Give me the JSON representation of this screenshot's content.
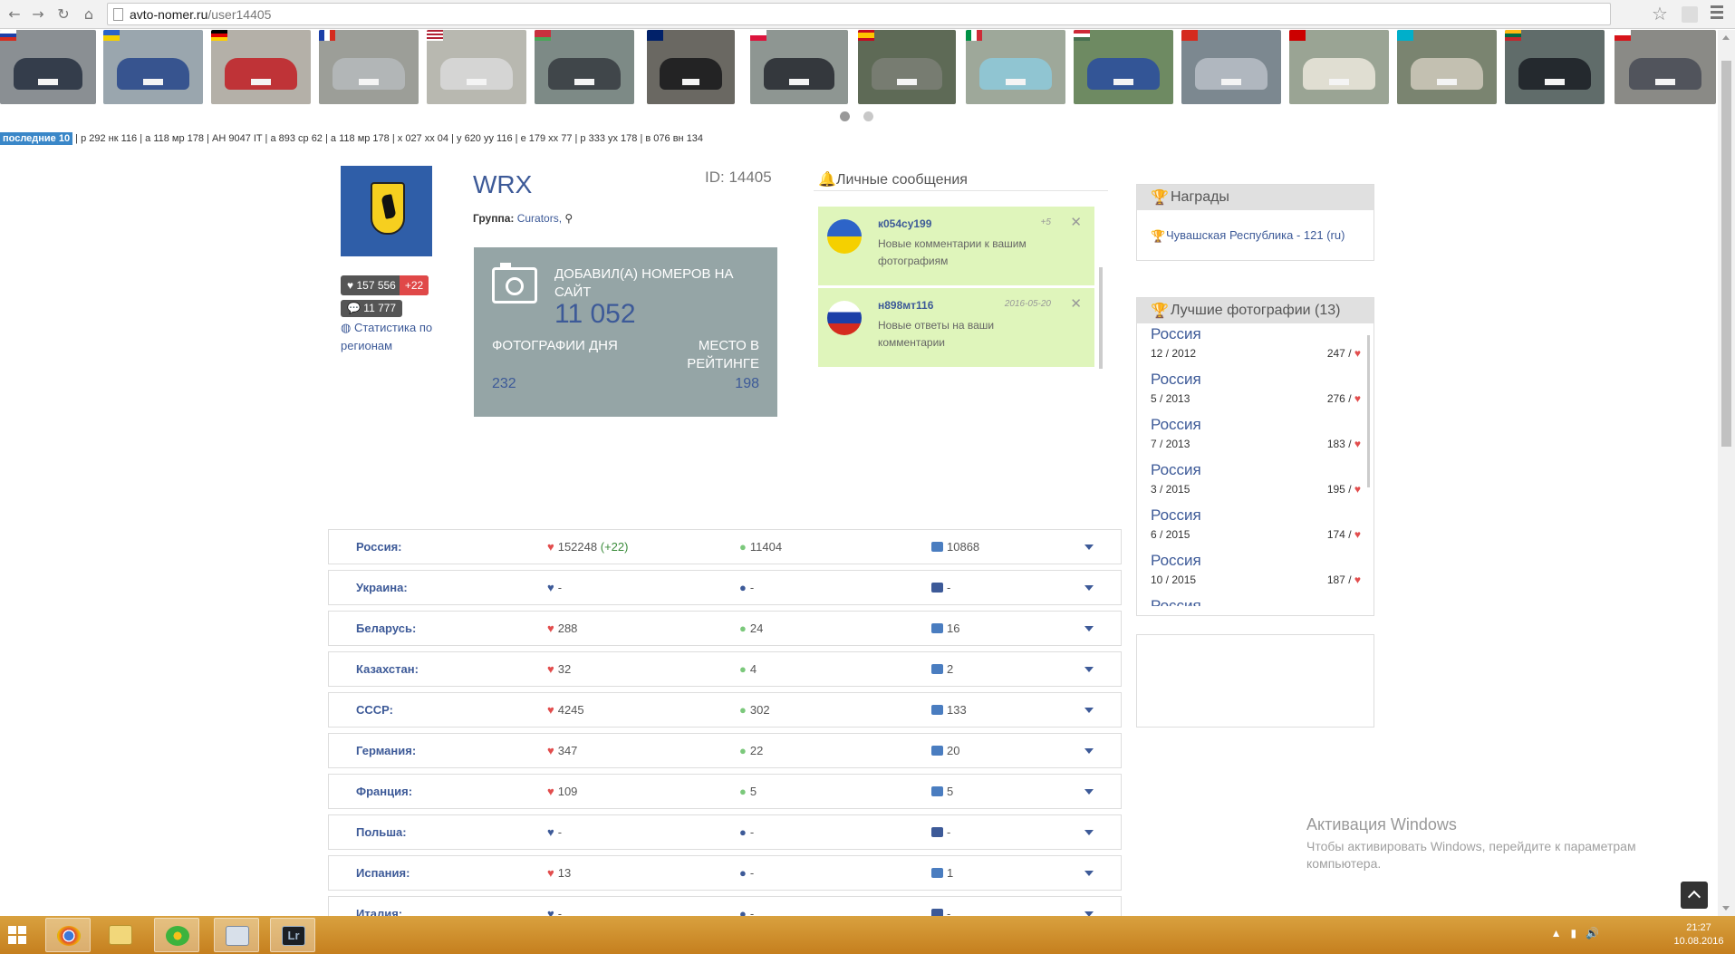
{
  "browser": {
    "url_host": "avto-nomer.ru",
    "url_path": "/user14405"
  },
  "last10": {
    "badge": "последние 10",
    "items": [
      "р 292 нк 116",
      "а 118 мр 178",
      "АН 9047 IT",
      "а 893 ср 62",
      "а 118 мр 178",
      "х 027 хх 04",
      "у 620 уу 116",
      "е 179 хх 77",
      "р 333 ух 178",
      "в 076 вн 134"
    ]
  },
  "user": {
    "name": "WRX",
    "id_text": "ID: 14405",
    "group_label": "Группа:",
    "group_value": "Curators,",
    "likes": "157 556",
    "likes_plus": "+22",
    "comments": "11 777",
    "stats_link": "Статистика по регионам"
  },
  "stats_box": {
    "added_label": "ДОБАВИЛ(А) НОМЕРОВ НА САЙТ",
    "added_value": "11 052",
    "photo_of_day_label": "ФОТОГРАФИИ ДНЯ",
    "photo_of_day_value": "232",
    "rank_label": "МЕСТО В РЕЙТИНГЕ",
    "rank_value": "198"
  },
  "messages": {
    "title": "Личные сообщения",
    "items": [
      {
        "from": "к054су199",
        "meta": "+5",
        "text": "Новые комментарии к вашим фотографиям",
        "flag": "ua"
      },
      {
        "from": "н898мт116",
        "meta": "2016-05-20",
        "text": "Новые ответы на ваши комментарии",
        "flag": "ru"
      }
    ],
    "close_glyph": "✕"
  },
  "awards": {
    "title": "Награды",
    "items": [
      "Чувашская Республика - 121 (ru)"
    ]
  },
  "best_photos": {
    "title": "Лучшие фотографии (13)",
    "items": [
      {
        "country": "Россия",
        "date": "12 / 2012",
        "score": "247"
      },
      {
        "country": "Россия",
        "date": "5 / 2013",
        "score": "276"
      },
      {
        "country": "Россия",
        "date": "7 / 2013",
        "score": "183"
      },
      {
        "country": "Россия",
        "date": "3 / 2015",
        "score": "195"
      },
      {
        "country": "Россия",
        "date": "6 / 2015",
        "score": "174"
      },
      {
        "country": "Россия",
        "date": "10 / 2015",
        "score": "187"
      },
      {
        "country": "Россия",
        "date": "",
        "score": ""
      }
    ]
  },
  "country_stats": [
    {
      "name": "Россия:",
      "likes": "152248",
      "likes_plus": "(+22)",
      "comments": "11404",
      "photos": "10868"
    },
    {
      "name": "Украина:",
      "likes": "-",
      "likes_plus": "",
      "comments": "-",
      "photos": "-"
    },
    {
      "name": "Беларусь:",
      "likes": "288",
      "likes_plus": "",
      "comments": "24",
      "photos": "16"
    },
    {
      "name": "Казахстан:",
      "likes": "32",
      "likes_plus": "",
      "comments": "4",
      "photos": "2"
    },
    {
      "name": "СССР:",
      "likes": "4245",
      "likes_plus": "",
      "comments": "302",
      "photos": "133"
    },
    {
      "name": "Германия:",
      "likes": "347",
      "likes_plus": "",
      "comments": "22",
      "photos": "20"
    },
    {
      "name": "Франция:",
      "likes": "109",
      "likes_plus": "",
      "comments": "5",
      "photos": "5"
    },
    {
      "name": "Польша:",
      "likes": "-",
      "likes_plus": "",
      "comments": "-",
      "photos": "-"
    },
    {
      "name": "Испания:",
      "likes": "13",
      "likes_plus": "",
      "comments": "-",
      "photos": "1"
    },
    {
      "name": "Италия:",
      "likes": "-",
      "likes_plus": "",
      "comments": "-",
      "photos": "-"
    }
  ],
  "thumbnails": [
    {
      "flag": "ru",
      "bg": "#8a8f93",
      "car": "#2a3444"
    },
    {
      "flag": "ua",
      "bg": "#9aa6ae",
      "car": "#2c4b8c"
    },
    {
      "flag": "de",
      "bg": "#b4b0a8",
      "car": "#c0262a"
    },
    {
      "flag": "fr",
      "bg": "#9c9e98",
      "car": "#b5b8ba"
    },
    {
      "flag": "us",
      "bg": "#b8b8b0",
      "car": "#d8d8d8"
    },
    {
      "flag": "by",
      "bg": "#7d8a86",
      "car": "#3a3e44"
    },
    {
      "flag": "gb",
      "bg": "#6a6862",
      "car": "#1c1c1e"
    },
    {
      "flag": "pl",
      "bg": "#8e9692",
      "car": "#2a2e34"
    },
    {
      "flag": "es",
      "bg": "#5e6a56",
      "car": "#7a7e74"
    },
    {
      "flag": "it",
      "bg": "#9ea89a",
      "car": "#8ec8d8"
    },
    {
      "flag": "hu",
      "bg": "#6e8a62",
      "car": "#2c4f9c"
    },
    {
      "flag": "ch",
      "bg": "#7c8890",
      "car": "#b6bcc4"
    },
    {
      "flag": "su",
      "bg": "#9aa494",
      "car": "#e8e4d8"
    },
    {
      "flag": "kz",
      "bg": "#7a8470",
      "car": "#cbc6b8"
    },
    {
      "flag": "lt",
      "bg": "#606c6a",
      "car": "#1e2228"
    },
    {
      "flag": "cz",
      "bg": "#8a8a86",
      "car": "#4a4e58"
    }
  ],
  "activation": {
    "title": "Активация Windows",
    "text": "Чтобы активировать Windows, перейдите к параметрам компьютера."
  },
  "clock": {
    "time": "21:27",
    "date": "10.08.2016"
  }
}
